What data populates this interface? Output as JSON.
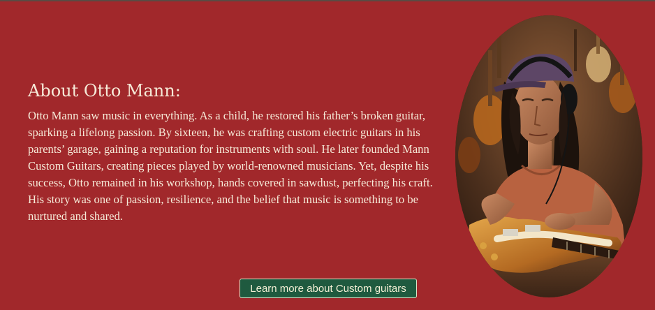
{
  "about": {
    "title": "About Otto Mann:",
    "body": "Otto Mann saw music in everything. As a child, he restored his father’s broken guitar, sparking a lifelong passion. By sixteen, he was crafting custom electric guitars in his parents’ garage, gaining a reputation for instruments with soul. He later founded Mann Custom Guitars, creating pieces played by world-renowned musicians. Yet, despite his success, Otto remained in his workshop, hands covered in sawdust, perfecting his craft. His story was one of passion, resilience, and the belief that music is something to be nurtured and shared.",
    "cta_label": "Learn more about Custom guitars"
  },
  "colors": {
    "background": "#a1282b",
    "text": "#f6ead8",
    "button_bg": "#1f5a3f",
    "button_border": "#d8e6c8"
  }
}
